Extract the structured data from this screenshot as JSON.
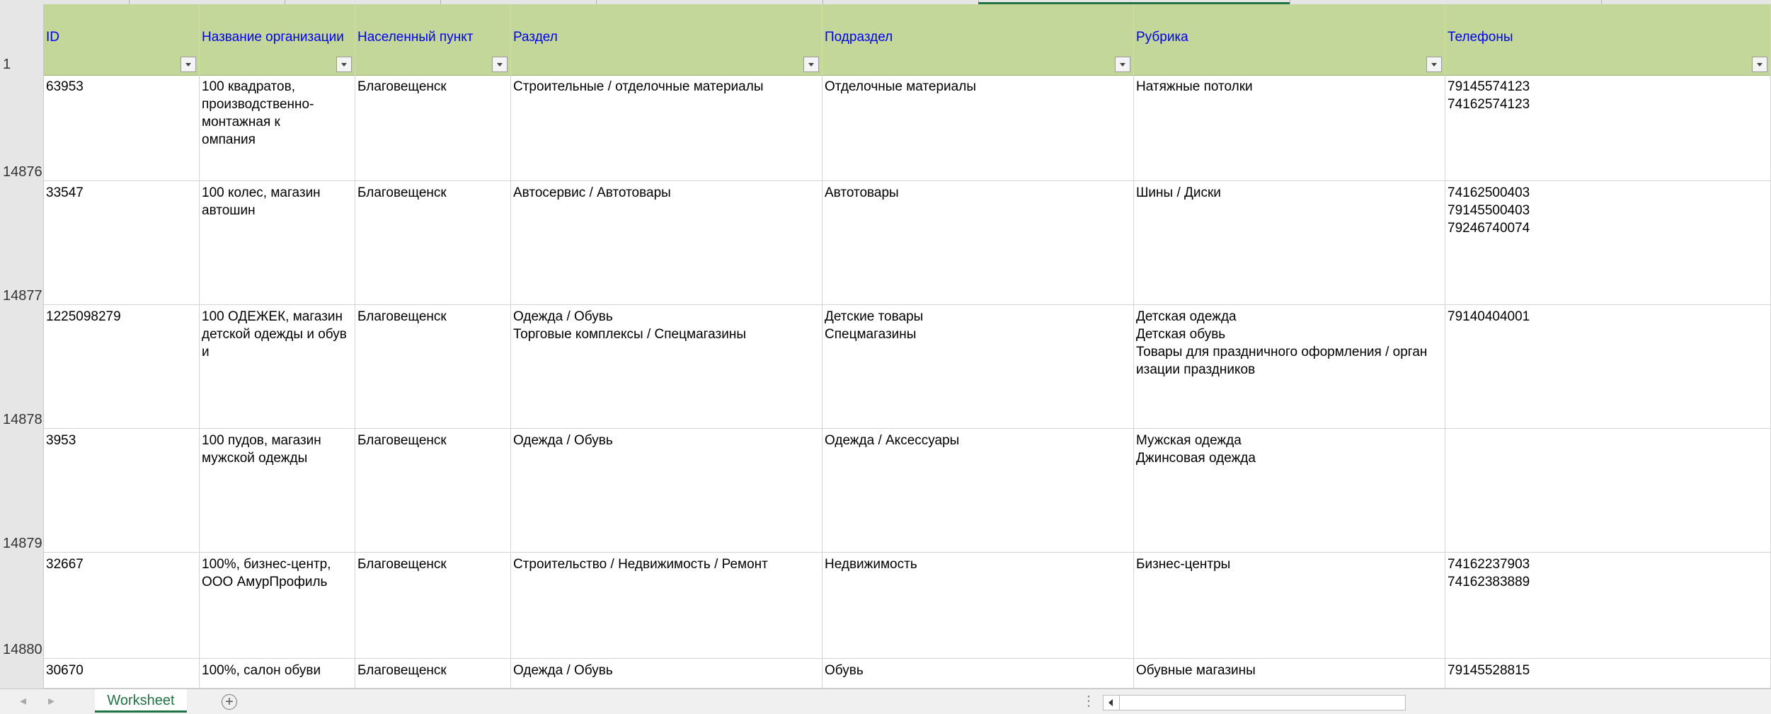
{
  "sheet": {
    "header_row_number": "1",
    "columns": [
      {
        "label": "ID"
      },
      {
        "label": "Название организации"
      },
      {
        "label": "Населенный пункт"
      },
      {
        "label": "Раздел"
      },
      {
        "label": "Подраздел"
      },
      {
        "label": "Рубрика"
      },
      {
        "label": "Телефоны"
      }
    ],
    "rows": [
      {
        "num": "14876",
        "cells": [
          "63953",
          "100 квадратов, производственно-монтажная к\nомпания",
          "Благовещенск",
          "Строительные / отделочные материалы",
          "Отделочные материалы",
          "Натяжные потолки",
          "79145574123\n74162574123"
        ]
      },
      {
        "num": "14877",
        "cells": [
          "33547",
          "100 колес, магазин автошин",
          "Благовещенск",
          "Автосервис / Автотовары",
          "Автотовары",
          "Шины / Диски",
          "74162500403\n79145500403\n79246740074"
        ]
      },
      {
        "num": "14878",
        "cells": [
          "1225098279",
          "100 ОДЕЖЕК, магазин детской одежды и обув\nи",
          "Благовещенск",
          "Одежда / Обувь\nТорговые комплексы / Спецмагазины",
          "Детские товары\nСпецмагазины",
          "Детская одежда\nДетская обувь\nТовары для праздничного оформления / орган\nизации праздников",
          "79140404001"
        ]
      },
      {
        "num": "14879",
        "cells": [
          "3953",
          "100 пудов, магазин мужской одежды",
          "Благовещенск",
          "Одежда / Обувь",
          "Одежда / Аксессуары",
          "Мужская одежда\nДжинсовая одежда",
          ""
        ]
      },
      {
        "num": "14880",
        "cells": [
          "32667",
          "100%, бизнес-центр, ООО АмурПрофиль",
          "Благовещенск",
          "Строительство / Недвижимость / Ремонт",
          "Недвижимость",
          "Бизнес-центры",
          "74162237903\n74162383889"
        ]
      },
      {
        "num": "",
        "cells": [
          "30670",
          "100%, салон обуви",
          "Благовещенск",
          "Одежда / Обувь",
          "Обувь",
          "Обувные магазины",
          "79145528815"
        ]
      }
    ]
  },
  "tabs": {
    "active_label": "Worksheet",
    "add_icon": "plus-circle-icon",
    "prev_icon": "tab-prev-icon",
    "next_icon": "tab-next-icon"
  },
  "colors": {
    "header_fill": "#c4d79b",
    "header_text": "#0000ee",
    "accent": "#217346"
  }
}
